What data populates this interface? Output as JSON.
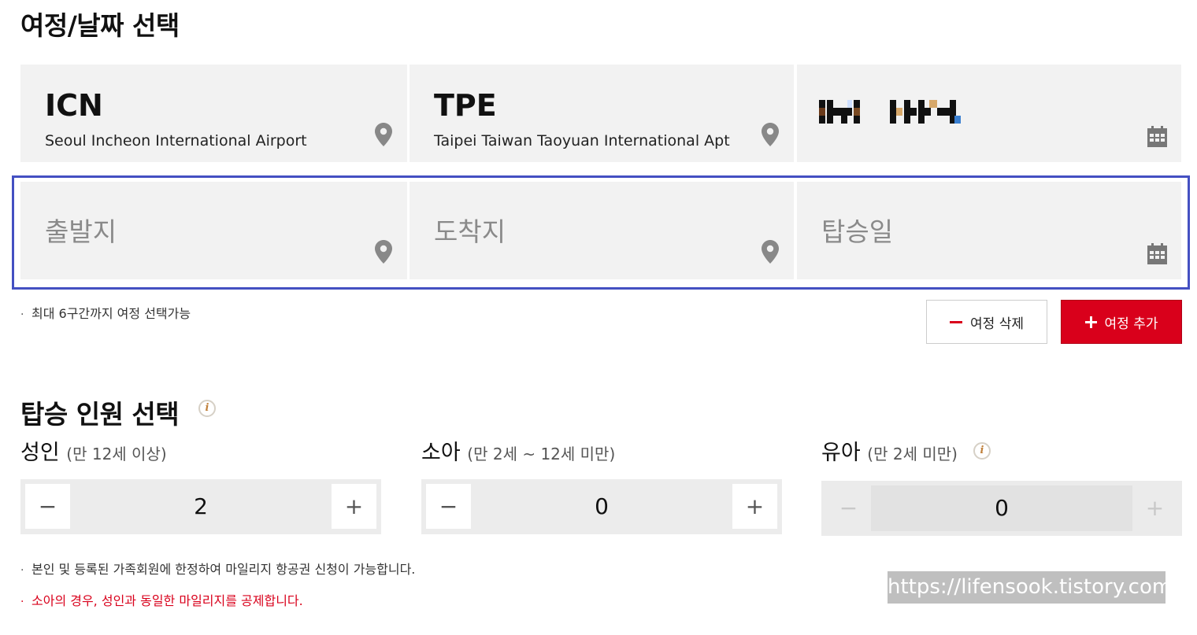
{
  "itinerary": {
    "title": "여정/날짜 선택",
    "segment1": {
      "origin": {
        "code": "ICN",
        "name": "Seoul Incheon International Airport"
      },
      "destination": {
        "code": "TPE",
        "name": "Taipei Taiwan Taoyuan International Apt"
      },
      "date": ""
    },
    "segment2": {
      "origin_placeholder": "출발지",
      "destination_placeholder": "도착지",
      "date_placeholder": "탑승일"
    },
    "note": "최대 6구간까지 여정 선택가능",
    "delete_label": "여정 삭제",
    "add_label": "여정 추가"
  },
  "passengers": {
    "title": "탑승 인원 선택",
    "adult": {
      "label": "성인",
      "sub": "(만 12세 이상)",
      "count": "2"
    },
    "child": {
      "label": "소아",
      "sub": "(만 2세 ~ 12세 미만)",
      "count": "0"
    },
    "infant": {
      "label": "유아",
      "sub": "(만 2세 미만)",
      "count": "0"
    },
    "minus": "−",
    "plus": "+",
    "notes": [
      "본인 및 등록된 가족회원에 한정하여 마일리지 항공권 신청이 가능합니다.",
      "소아의 경우, 성인과 동일한 마일리지를 공제합니다."
    ],
    "info_glyph": "i"
  },
  "watermark": "https://lifensook.tistory.com",
  "colors": {
    "accent": "#d9001b",
    "highlight_border": "#4450c2",
    "cell_bg": "#f2f2f2"
  }
}
